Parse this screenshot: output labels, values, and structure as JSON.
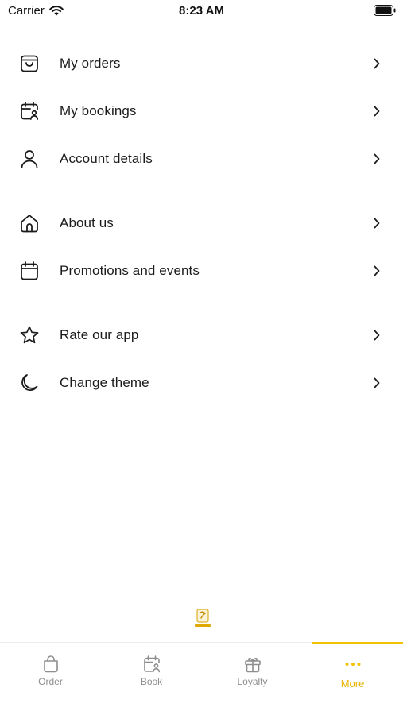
{
  "status_bar": {
    "carrier": "Carrier",
    "time": "8:23 AM"
  },
  "menu": {
    "groups": [
      [
        {
          "label": "My orders",
          "icon": "shopping-bag-icon"
        },
        {
          "label": "My bookings",
          "icon": "calendar-user-icon"
        },
        {
          "label": "Account details",
          "icon": "person-icon"
        }
      ],
      [
        {
          "label": "About us",
          "icon": "home-icon"
        },
        {
          "label": "Promotions and events",
          "icon": "calendar-icon"
        }
      ],
      [
        {
          "label": "Rate our app",
          "icon": "star-icon"
        },
        {
          "label": "Change theme",
          "icon": "moon-icon"
        }
      ]
    ]
  },
  "tabs": [
    {
      "label": "Order",
      "icon": "bag-icon",
      "active": false
    },
    {
      "label": "Book",
      "icon": "calendar-user-icon",
      "active": false
    },
    {
      "label": "Loyalty",
      "icon": "gift-icon",
      "active": false
    },
    {
      "label": "More",
      "icon": "more-dots-icon",
      "active": true
    }
  ],
  "colors": {
    "accent": "#f2c100",
    "accent_text": "#e6b400",
    "inactive_tab": "#8e8e8e",
    "divider": "#e9e9e9"
  }
}
